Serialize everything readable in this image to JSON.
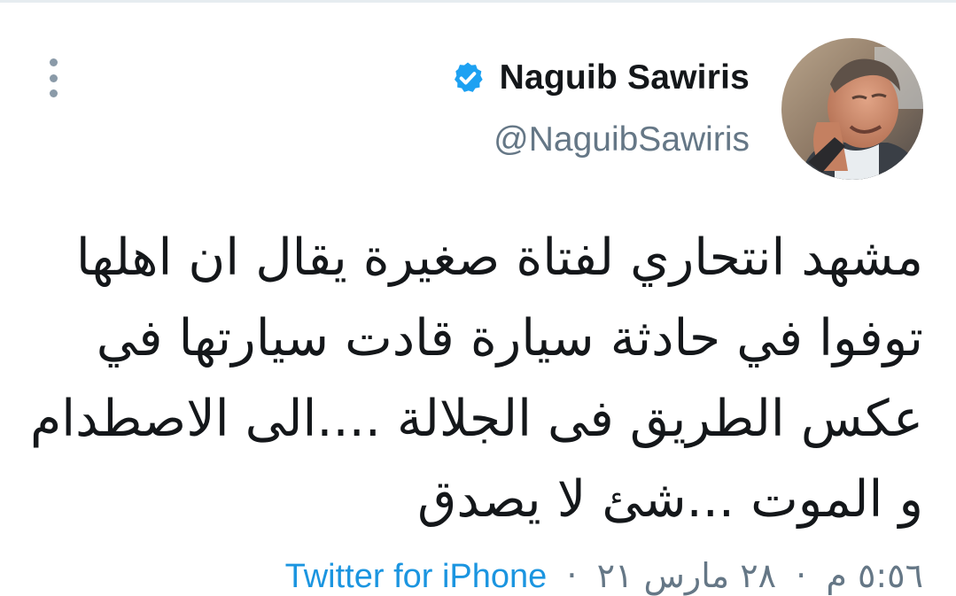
{
  "author": {
    "display_name": "Naguib Sawiris",
    "handle": "@NaguibSawiris",
    "verified_icon": "verified-badge-icon",
    "avatar_icon": "profile-photo"
  },
  "tweet": {
    "lines": [
      "مشهد انتحاري لفتاة صغيرة يقال ان اهلها",
      "توفوا في حادثة سيارة قادت سيارتها في",
      "عكس الطريق فى الجلالة ....الى الاصطدام",
      "و الموت ...شئ لا يصدق"
    ]
  },
  "meta": {
    "time": "٥:٥٦ م",
    "date": "٢٨ مارس ٢١",
    "separator": "·",
    "source": "Twitter for iPhone"
  },
  "menu": {
    "icon": "more-vertical-icon"
  },
  "colors": {
    "verified_blue": "#1da1f2",
    "link_blue": "#1b95e0",
    "secondary_text": "#657786",
    "primary_text": "#14171a"
  }
}
